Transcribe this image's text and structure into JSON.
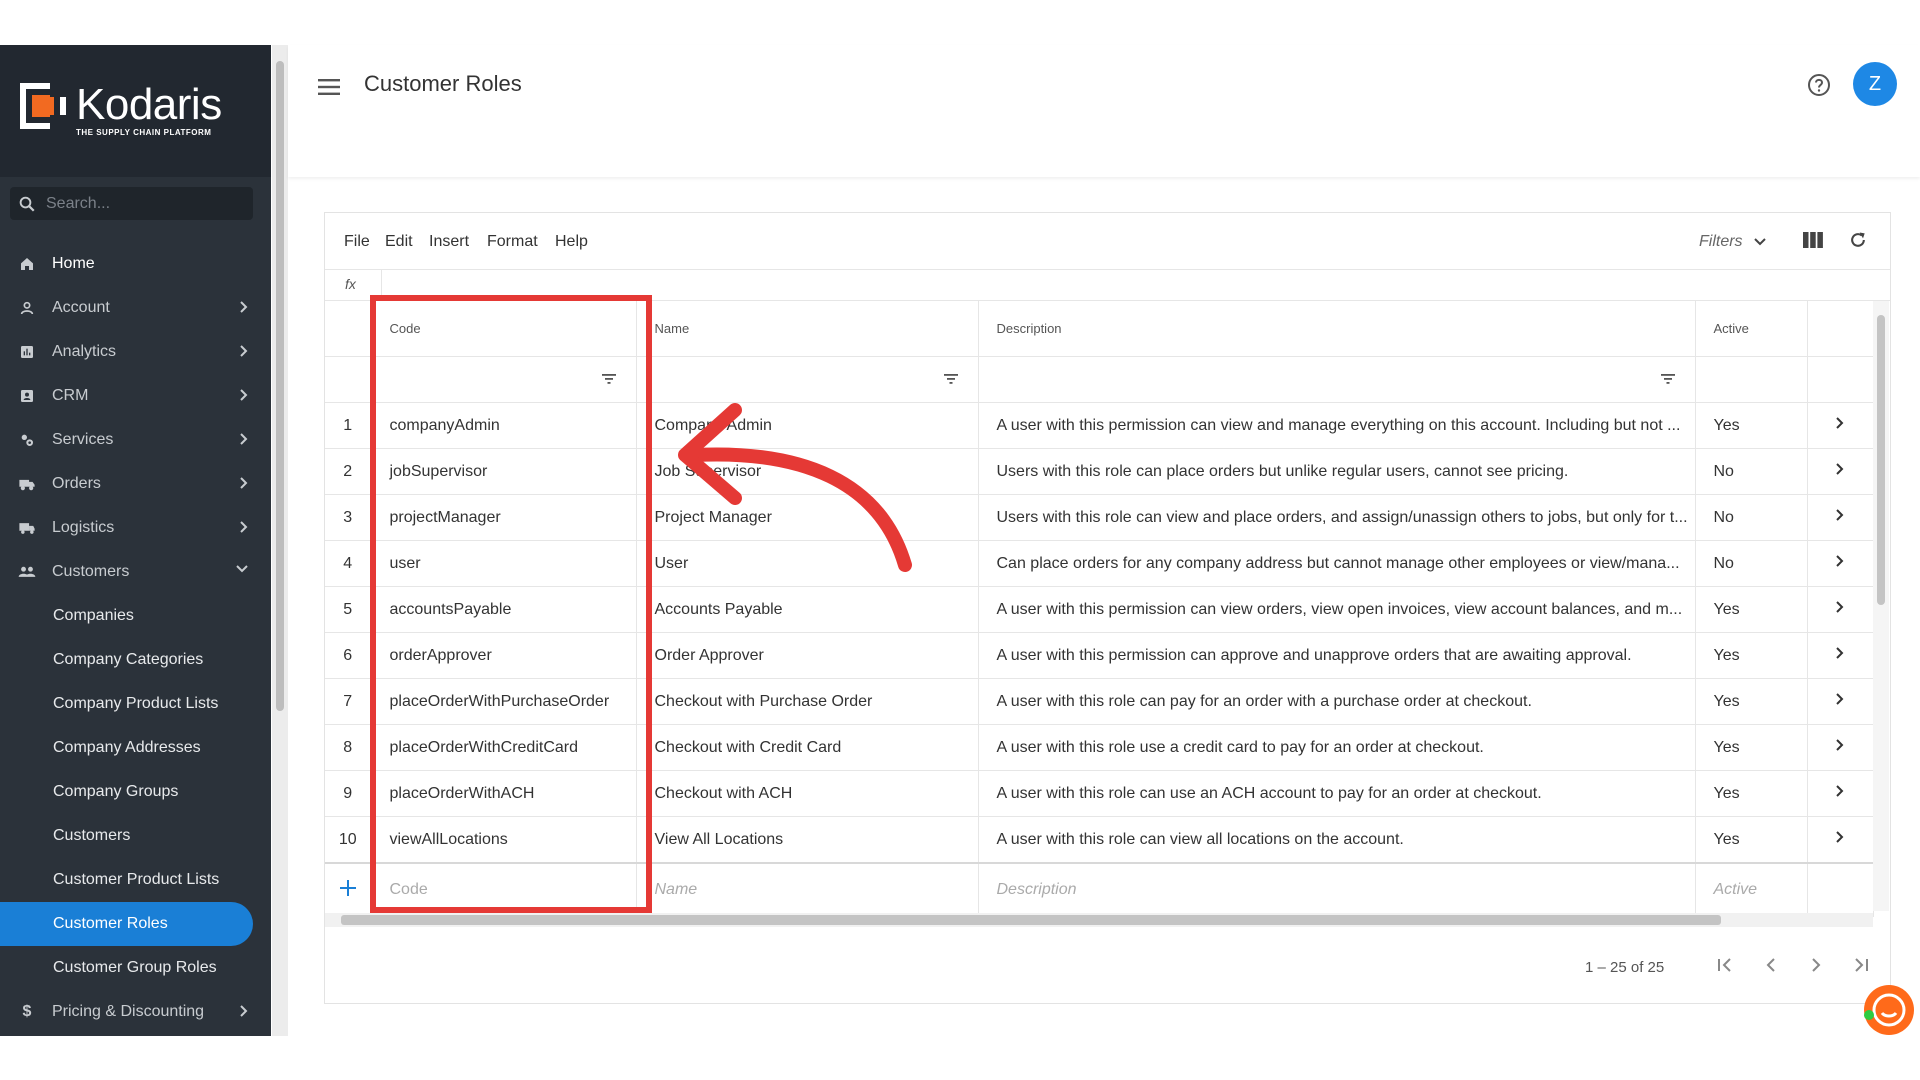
{
  "app": {
    "logo_name": "Kodaris",
    "logo_tagline": "THE SUPPLY CHAIN PLATFORM",
    "search_placeholder": "Search...",
    "page_title": "Customer Roles",
    "avatar_initial": "Z",
    "accent_color": "#1a7fd6"
  },
  "sidebar": {
    "items": [
      {
        "label": "Home",
        "icon": "home-icon"
      },
      {
        "label": "Account",
        "icon": "user-icon"
      },
      {
        "label": "Analytics",
        "icon": "chart-icon"
      },
      {
        "label": "CRM",
        "icon": "contacts-icon"
      },
      {
        "label": "Services",
        "icon": "services-icon"
      },
      {
        "label": "Orders",
        "icon": "truck-icon"
      },
      {
        "label": "Logistics",
        "icon": "delivery-icon"
      },
      {
        "label": "Customers",
        "icon": "people-icon"
      }
    ],
    "customers_sub": [
      "Companies",
      "Company Categories",
      "Company Product Lists",
      "Company Addresses",
      "Company Groups",
      "Customers",
      "Customer Product Lists",
      "Customer Roles",
      "Customer Group Roles"
    ],
    "pricing_label": "Pricing & Discounting"
  },
  "toolbar": {
    "menus": [
      "File",
      "Edit",
      "Insert",
      "Format",
      "Help"
    ],
    "filters_label": "Filters",
    "fx_label": "fx"
  },
  "grid": {
    "columns": {
      "code": "Code",
      "name": "Name",
      "description": "Description",
      "active": "Active"
    },
    "rows": [
      {
        "n": "1",
        "code": "companyAdmin",
        "name": "Company Admin",
        "description": "A user with this permission can view and manage everything on this account. Including but not ...",
        "active": "Yes"
      },
      {
        "n": "2",
        "code": "jobSupervisor",
        "name": "Job Supervisor",
        "description": "Users with this role can place orders but unlike regular users, cannot see pricing.",
        "active": "No"
      },
      {
        "n": "3",
        "code": "projectManager",
        "name": "Project Manager",
        "description": "Users with this role can view and place orders, and assign/unassign others to jobs, but only for t...",
        "active": "No"
      },
      {
        "n": "4",
        "code": "user",
        "name": "User",
        "description": "Can place orders for any company address but cannot manage other employees or view/mana...",
        "active": "No"
      },
      {
        "n": "5",
        "code": "accountsPayable",
        "name": "Accounts Payable",
        "description": "A user with this permission can view orders, view open invoices, view account balances, and m...",
        "active": "Yes"
      },
      {
        "n": "6",
        "code": "orderApprover",
        "name": "Order Approver",
        "description": "A user with this permission can approve and unapprove orders that are awaiting approval.",
        "active": "Yes"
      },
      {
        "n": "7",
        "code": "placeOrderWithPurchaseOrder",
        "name": "Checkout with Purchase Order",
        "description": "A user with this role can pay for an order with a purchase order at checkout.",
        "active": "Yes"
      },
      {
        "n": "8",
        "code": "placeOrderWithCreditCard",
        "name": "Checkout with Credit Card",
        "description": "A user with this role use a credit card to pay for an order at checkout.",
        "active": "Yes"
      },
      {
        "n": "9",
        "code": "placeOrderWithACH",
        "name": "Checkout with ACH",
        "description": "A user with this role can use an ACH account to pay for an order at checkout.",
        "active": "Yes"
      },
      {
        "n": "10",
        "code": "viewAllLocations",
        "name": "View All Locations",
        "description": "A user with this role can view all locations on the account.",
        "active": "Yes"
      }
    ],
    "new_row": {
      "code": "Code",
      "name": "Name",
      "description": "Description",
      "active": "Active"
    }
  },
  "paging": {
    "range_text": "1 – 25 of 25"
  },
  "annotation": {
    "color": "#e53935"
  }
}
